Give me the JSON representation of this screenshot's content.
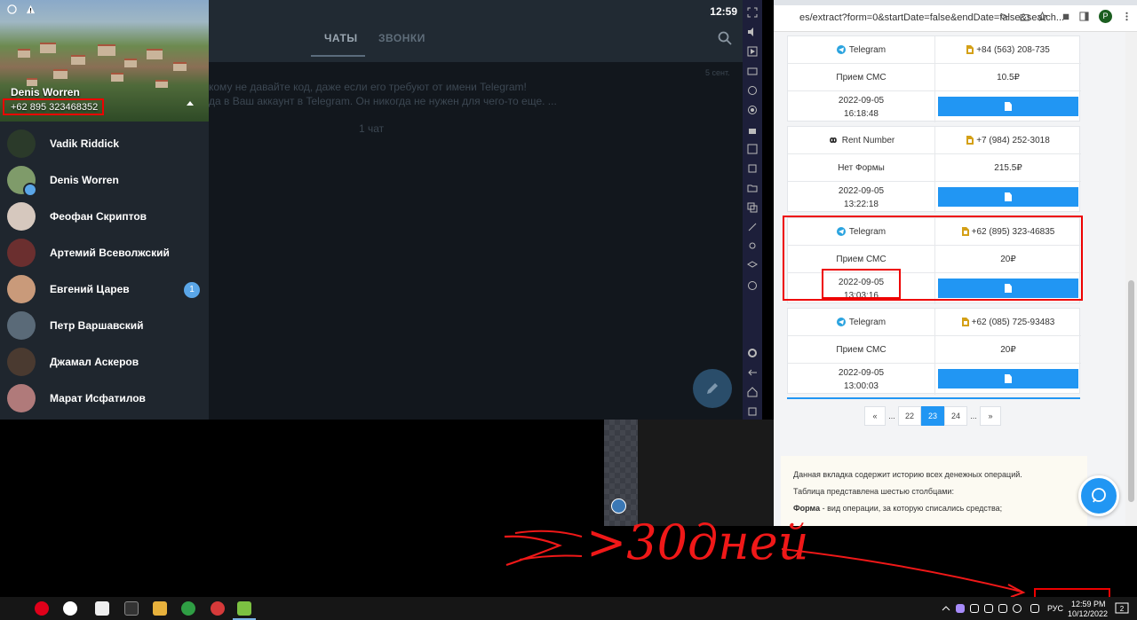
{
  "telegram": {
    "clock": "12:59",
    "tabs": [
      "ЧАТЫ",
      "ЗВОНКИ"
    ],
    "message_date": "5 сент.",
    "message_line1": "кому не давайте код, даже если его требуют от имени Telegram!",
    "message_line2": "да в Ваш аккаунт в Telegram. Он никогда не нужен для чего-то еще. ...",
    "chat_count": "1 чат",
    "drawer": {
      "user_name": "Denis Worren",
      "user_phone": "+62 895 323468352",
      "contacts": [
        {
          "name": "Vadik Riddick",
          "color": "#2b3a2a",
          "badge": ""
        },
        {
          "name": "Denis Worren",
          "color": "#7f9b6a",
          "badge": ""
        },
        {
          "name": "Феофан Скриптов",
          "color": "#d6c8be",
          "badge": ""
        },
        {
          "name": "Артемий Всеволжский",
          "color": "#6b2f2f",
          "badge": ""
        },
        {
          "name": "Евгений Царев",
          "color": "#c99a7a",
          "badge": "1"
        },
        {
          "name": "Петр Варшавский",
          "color": "#5a6a78",
          "badge": ""
        },
        {
          "name": "Джамал Аскеров",
          "color": "#4a3a30",
          "badge": ""
        },
        {
          "name": "Марат Исфатилов",
          "color": "#b07a7a",
          "badge": ""
        }
      ]
    }
  },
  "browser": {
    "url": "es/extract?form=0&startDate=false&endDate=false&search...",
    "profile_initial": "P",
    "records": [
      {
        "service": "Telegram",
        "service_icon": "telegram-icon",
        "phone": "+84 (563) 208-735",
        "type": "Прием СМС",
        "price": "10.5₽",
        "date": "2022-09-05",
        "time": "16:18:48"
      },
      {
        "service": "Rent Number",
        "service_icon": "infinity-icon",
        "phone": "+7 (984) 252-3018",
        "type": "Нет Формы",
        "price": "215.5₽",
        "date": "2022-09-05",
        "time": "13:22:18"
      },
      {
        "service": "Telegram",
        "service_icon": "telegram-icon",
        "phone": "+62 (895) 323-46835",
        "type": "Прием СМС",
        "price": "20₽",
        "date": "2022-09-05",
        "time": "13:03:16"
      },
      {
        "service": "Telegram",
        "service_icon": "telegram-icon",
        "phone": "+62 (085) 725-93483",
        "type": "Прием СМС",
        "price": "20₽",
        "date": "2022-09-05",
        "time": "13:00:03"
      }
    ],
    "pagination": {
      "prev": "«",
      "ellipsis1": "...",
      "pages": [
        "22",
        "23",
        "24"
      ],
      "active": "23",
      "ellipsis2": "...",
      "next": "»"
    },
    "info": {
      "line1": "Данная вкладка содержит историю всех денежных операций.",
      "line2": "Таблица представлена шестью столбцами:",
      "line3_bold": "Форма",
      "line3_rest": " - вид операции, за которую списались средства;"
    }
  },
  "annotation": {
    "handwriting": ">30дней"
  },
  "taskbar": {
    "language": "РУС",
    "time": "12:59 PM",
    "date": "10/12/2022",
    "notif_count": "2"
  }
}
